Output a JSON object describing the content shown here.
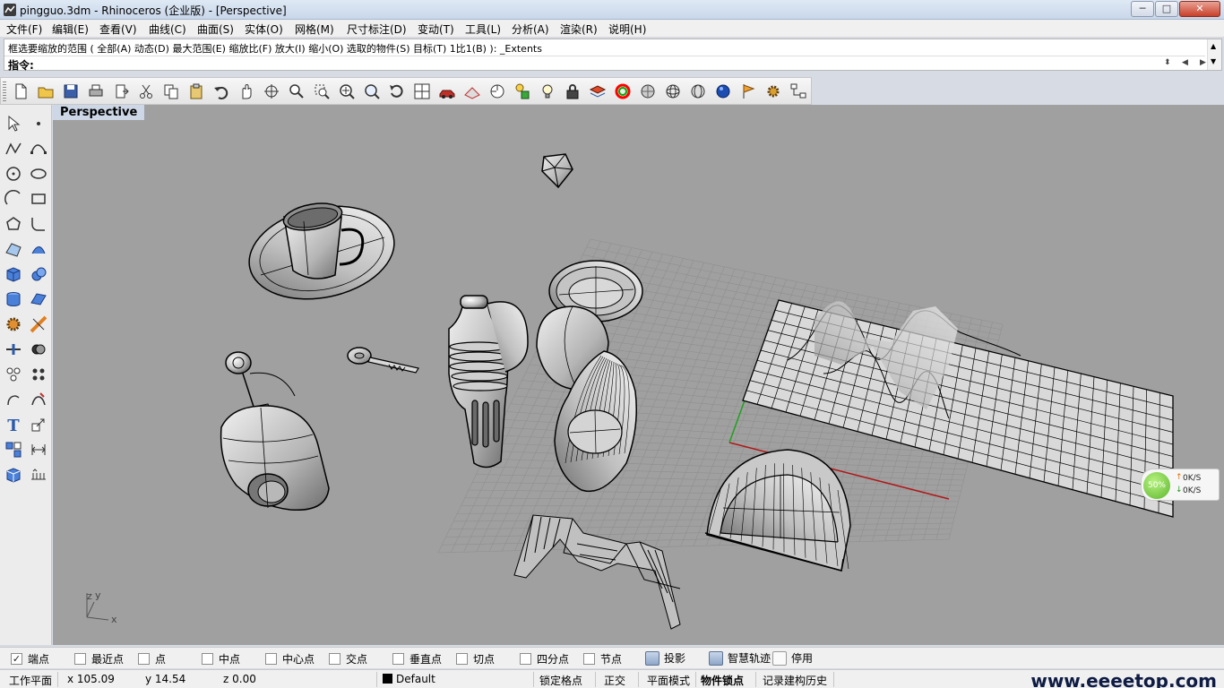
{
  "window": {
    "title": "pingguo.3dm - Rhinoceros (企业版) - [Perspective]",
    "minimize": "─",
    "maximize": "□",
    "close": "✕"
  },
  "menu": [
    "文件(F)",
    "编辑(E)",
    "查看(V)",
    "曲线(C)",
    "曲面(S)",
    "实体(O)",
    "网格(M)",
    "尺寸标注(D)",
    "变动(T)",
    "工具(L)",
    "分析(A)",
    "渲染(R)",
    "说明(H)"
  ],
  "command": {
    "history": "框选要缩放的范围 ( 全部(A) 动态(D) 最大范围(E) 缩放比(F) 放大(I) 缩小(O) 选取的物件(S) 目标(T) 1比1(B) ): _Extents",
    "prompt": "指令:",
    "value": ""
  },
  "toolbar_icons": [
    "new-file-icon",
    "open-file-icon",
    "save-icon",
    "print-icon",
    "import-icon",
    "cut-icon",
    "copy-icon",
    "paste-icon",
    "undo-icon",
    "pan-hand-icon",
    "rotate-view-icon",
    "zoom-icon",
    "zoom-window-icon",
    "zoom-extents-icon",
    "zoom-selected-icon",
    "rotate-icon",
    "four-viewports-icon",
    "car-icon",
    "cplane-icon",
    "snap-target-icon",
    "show-hide-icon",
    "light-bulb-icon",
    "lock-icon",
    "layer-icon",
    "color-wheel-icon",
    "render-sphere-icon",
    "wireframe-sphere-icon",
    "grid-sphere-icon",
    "blue-sphere-icon",
    "flag-icon",
    "gear-options-icon",
    "command-flow-icon",
    "help-icon"
  ],
  "left_tool_icons": [
    "select-arrow-icon",
    "point-icon",
    "polyline-icon",
    "curve-points-icon",
    "circle-icon",
    "ellipse-icon",
    "arc-icon",
    "rectangle-icon",
    "polygon-icon",
    "fillet-curve-icon",
    "surface-points-icon",
    "surface-edge-icon",
    "box-icon",
    "sphere-icon",
    "cylinder-icon",
    "plane-surface-icon",
    "explode-gear-icon",
    "trim-icon",
    "split-icon",
    "boolean-icon",
    "group-icon",
    "array-icon",
    "rotate-curve-icon",
    "curve-edit-icon",
    "text-icon",
    "scale-icon",
    "block-icon",
    "dimension-icon",
    "cube-view-icon",
    "grid-tool-icon"
  ],
  "viewport": {
    "tab": "Perspective",
    "axis_y": "y",
    "axis_z": "z",
    "axis_x": "x"
  },
  "net_widget": {
    "percent": "50%",
    "up_rate": "0K/S",
    "down_rate": "0K/S"
  },
  "osnaps": [
    {
      "label": "端点",
      "checked": true
    },
    {
      "label": "最近点",
      "checked": false
    },
    {
      "label": "点",
      "checked": false
    },
    {
      "label": "中点",
      "checked": false
    },
    {
      "label": "中心点",
      "checked": false
    },
    {
      "label": "交点",
      "checked": false
    },
    {
      "label": "垂直点",
      "checked": false
    },
    {
      "label": "切点",
      "checked": false
    },
    {
      "label": "四分点",
      "checked": false
    },
    {
      "label": "节点",
      "checked": false
    }
  ],
  "osnap_extra": {
    "project": "投影",
    "smarttrack": "智慧轨迹",
    "disable": "停用"
  },
  "status": {
    "cplane": "工作平面",
    "x": "x 105.09",
    "y": "y 14.54",
    "z": "z 0.00",
    "layer": "Default",
    "grid_snap": "锁定格点",
    "ortho": "正交",
    "planar": "平面模式",
    "osnap": "物件锁点",
    "history": "记录建构历史",
    "watermark": "www.eeeetop.com"
  },
  "colors": {
    "viewport_bg": "#a0a0a0",
    "tab_bg": "#cdd7e6",
    "x_axis": "#b01818",
    "y_axis": "#1ea01e"
  }
}
